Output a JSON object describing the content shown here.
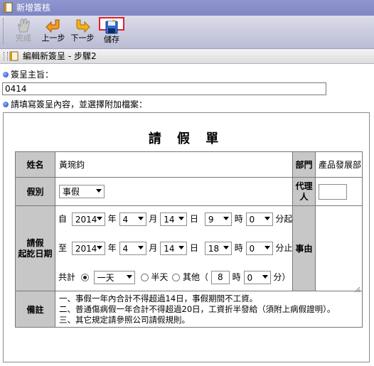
{
  "window": {
    "title": "新增簽核"
  },
  "toolbar": {
    "finish_label": "完成",
    "prev_label": "上一步",
    "next_label": "下一步",
    "save_label": "儲存"
  },
  "step": {
    "label": "編輯新簽呈 - 步驟2"
  },
  "subject": {
    "label": "簽呈主旨：",
    "value": "0414"
  },
  "content_prompt": "請填寫簽呈內容，並選擇附加檔案：",
  "form": {
    "title": "請 假 單",
    "name_label": "姓名",
    "name_value": "黃琬鈞",
    "dept_label": "部門",
    "dept_value": "產品發展部",
    "type_label": "假別",
    "type_value": "事假",
    "agent_label": "代理人",
    "agent_value": "",
    "period_label": "請假\n起訖日期",
    "reason_label": "事由",
    "reason_value": "",
    "start": {
      "prefix": "自",
      "year": "2014",
      "month": "4",
      "day": "14",
      "hour": "9",
      "minute": "0",
      "suffix": "分起"
    },
    "end": {
      "prefix": "至",
      "year": "2014",
      "month": "4",
      "day": "14",
      "hour": "18",
      "minute": "0",
      "suffix": "分止"
    },
    "units": {
      "year": "年",
      "month": "月",
      "day": "日",
      "hour": "時"
    },
    "total": {
      "label": "共計",
      "day_option": "一天",
      "half_label": "半天",
      "other_label": "其他（",
      "other_hours": "8",
      "hour_unit": "時",
      "other_minutes": "0",
      "minute_unit": "分）",
      "selected": "day"
    },
    "note_label": "備註",
    "notes": [
      "一、事假一年內合計不得超過14日，事假期間不工資。",
      "二、普通傷病假一年合計不得超過20日，工資折半發給（須附上病假證明）。",
      "三、其它規定請參照公司請假規則。"
    ]
  }
}
